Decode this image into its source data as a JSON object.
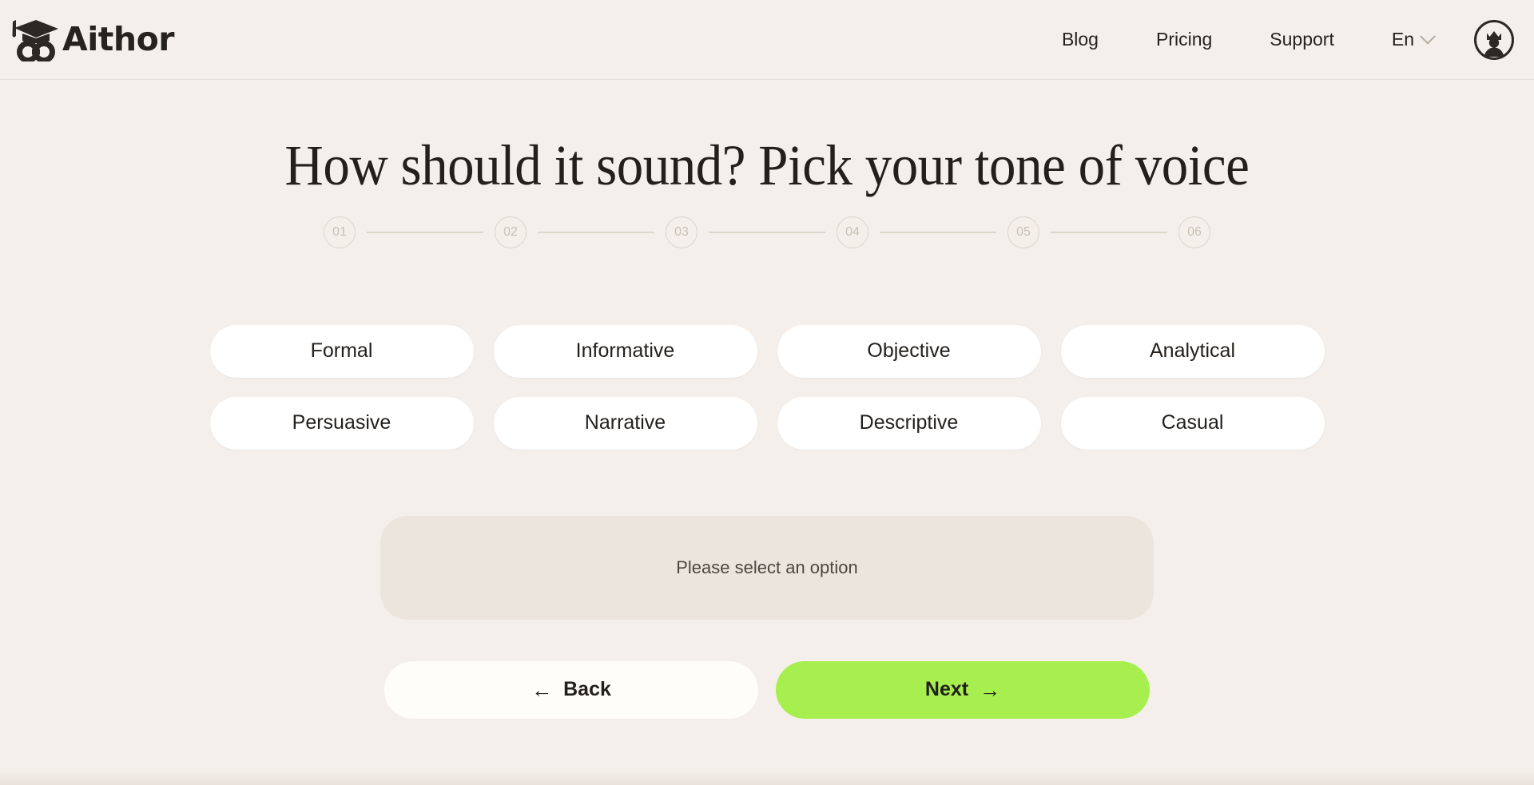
{
  "brand": {
    "name": "Aithor",
    "logo_icon": "graduation-cap-infinity-logo"
  },
  "header": {
    "nav": [
      {
        "label": "Blog",
        "name": "blog"
      },
      {
        "label": "Pricing",
        "name": "pricing"
      },
      {
        "label": "Support",
        "name": "support"
      }
    ],
    "language": {
      "label": "En",
      "chevron_icon": "chevron-down-icon"
    },
    "avatar": {
      "icon": "crown-user-avatar-icon"
    }
  },
  "main": {
    "title": "How should it sound? Pick your tone of voice",
    "stepper": {
      "steps": [
        "01",
        "02",
        "03",
        "04",
        "05",
        "06"
      ],
      "active_index": null
    },
    "options": [
      {
        "label": "Formal"
      },
      {
        "label": "Informative"
      },
      {
        "label": "Objective"
      },
      {
        "label": "Analytical"
      },
      {
        "label": "Persuasive"
      },
      {
        "label": "Narrative"
      },
      {
        "label": "Descriptive"
      },
      {
        "label": "Casual"
      }
    ],
    "hint": "Please select an option",
    "actions": {
      "back": {
        "label": "Back",
        "arrow": "←",
        "icon": "arrow-left-icon"
      },
      "next": {
        "label": "Next",
        "arrow": "→",
        "icon": "arrow-right-icon"
      }
    }
  },
  "colors": {
    "background": "#f4efea",
    "surface": "#ffffff",
    "hint_surface": "#ece5de",
    "accent_green": "#a7ef4e",
    "text": "#221f1c",
    "muted": "#cbc1b7",
    "divider": "#e6ded6"
  }
}
